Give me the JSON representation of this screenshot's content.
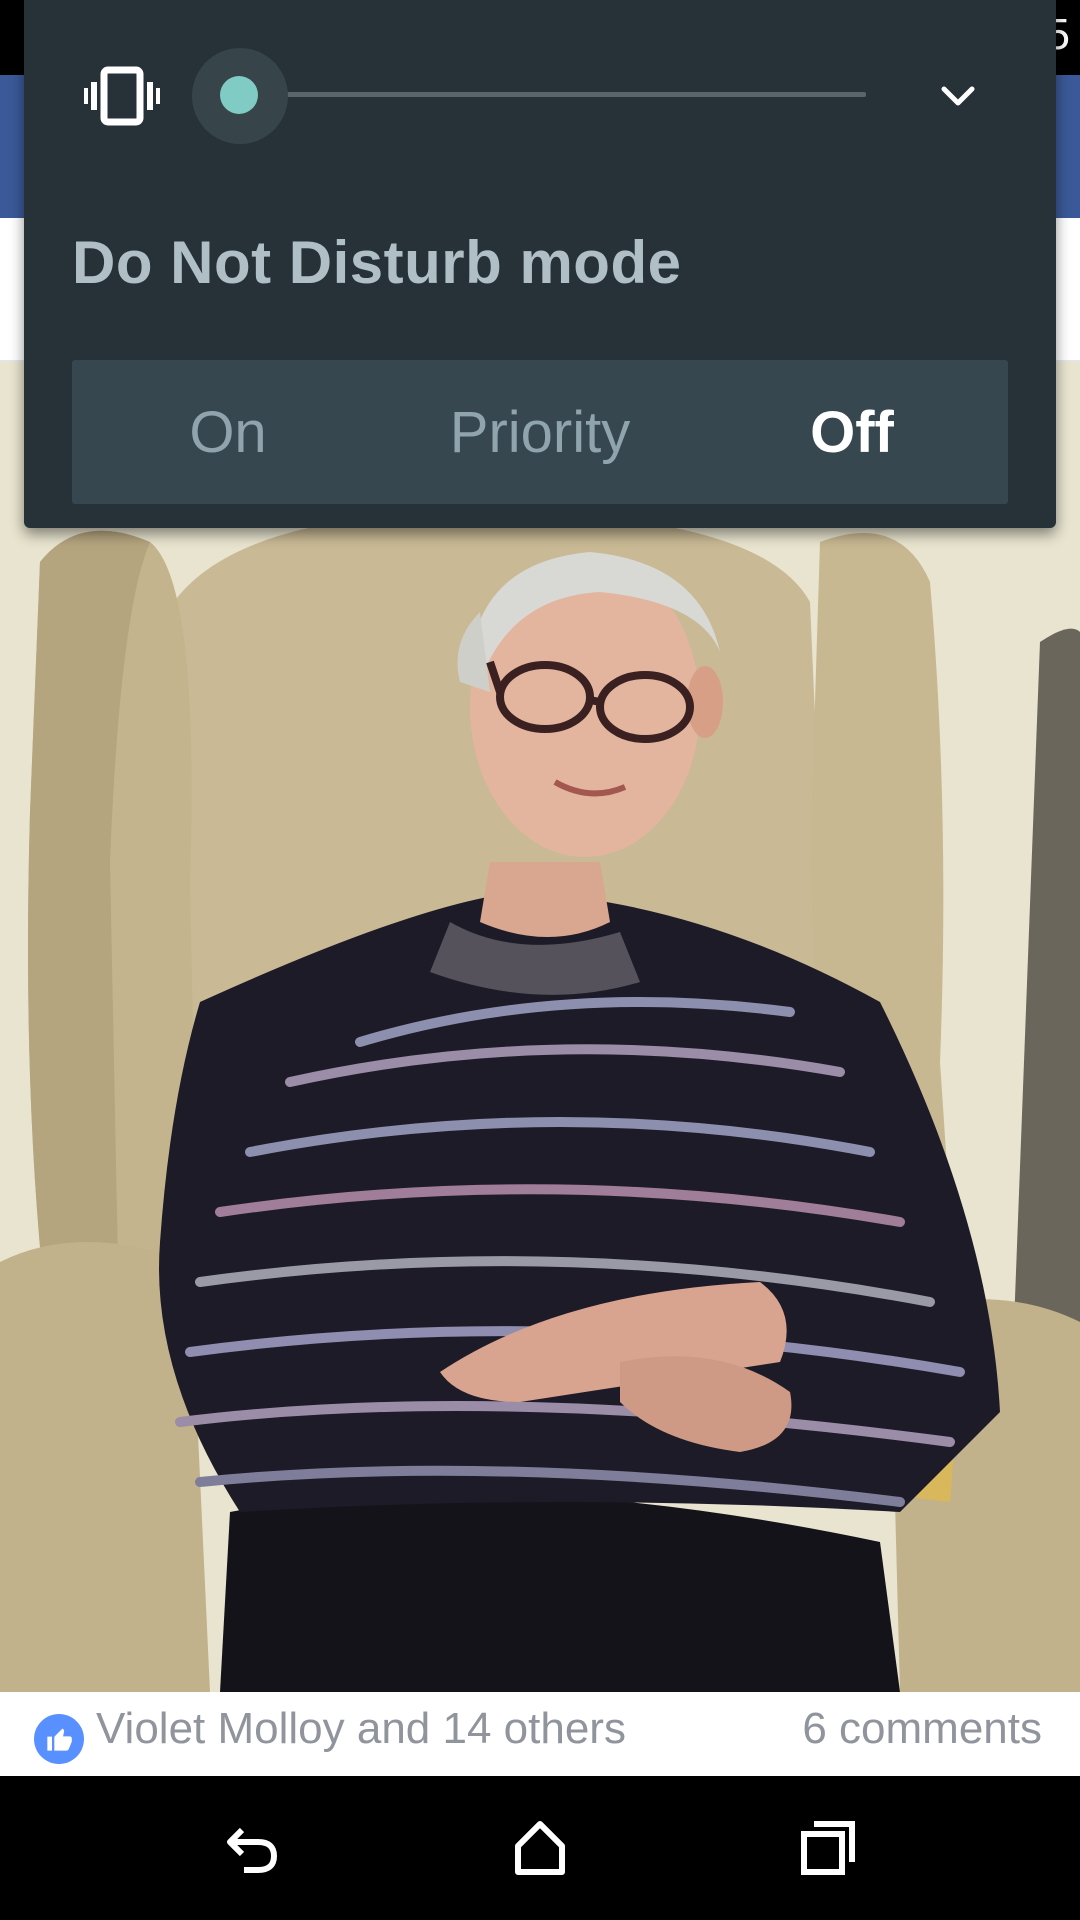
{
  "status_bar": {
    "clock_fragment": "5"
  },
  "dnd_panel": {
    "ringer_icon": "vibrate-icon",
    "volume_level": 0,
    "expand_icon": "chevron-down-icon",
    "title": "Do Not Disturb mode",
    "modes": [
      {
        "label": "On",
        "selected": false
      },
      {
        "label": "Priority",
        "selected": false
      },
      {
        "label": "Off",
        "selected": true
      }
    ]
  },
  "post": {
    "like_icon": "thumbs-up-icon",
    "likes_text": "Violet Molloy and 14 others",
    "comments_text": "6 comments"
  },
  "nav_bar": {
    "back_icon": "back-icon",
    "home_icon": "home-icon",
    "recents_icon": "recents-icon"
  },
  "colors": {
    "panel_bg": "#263238",
    "accent": "#80cbc4",
    "facebook_blue": "#3b5998",
    "like_blue": "#5890ff"
  }
}
